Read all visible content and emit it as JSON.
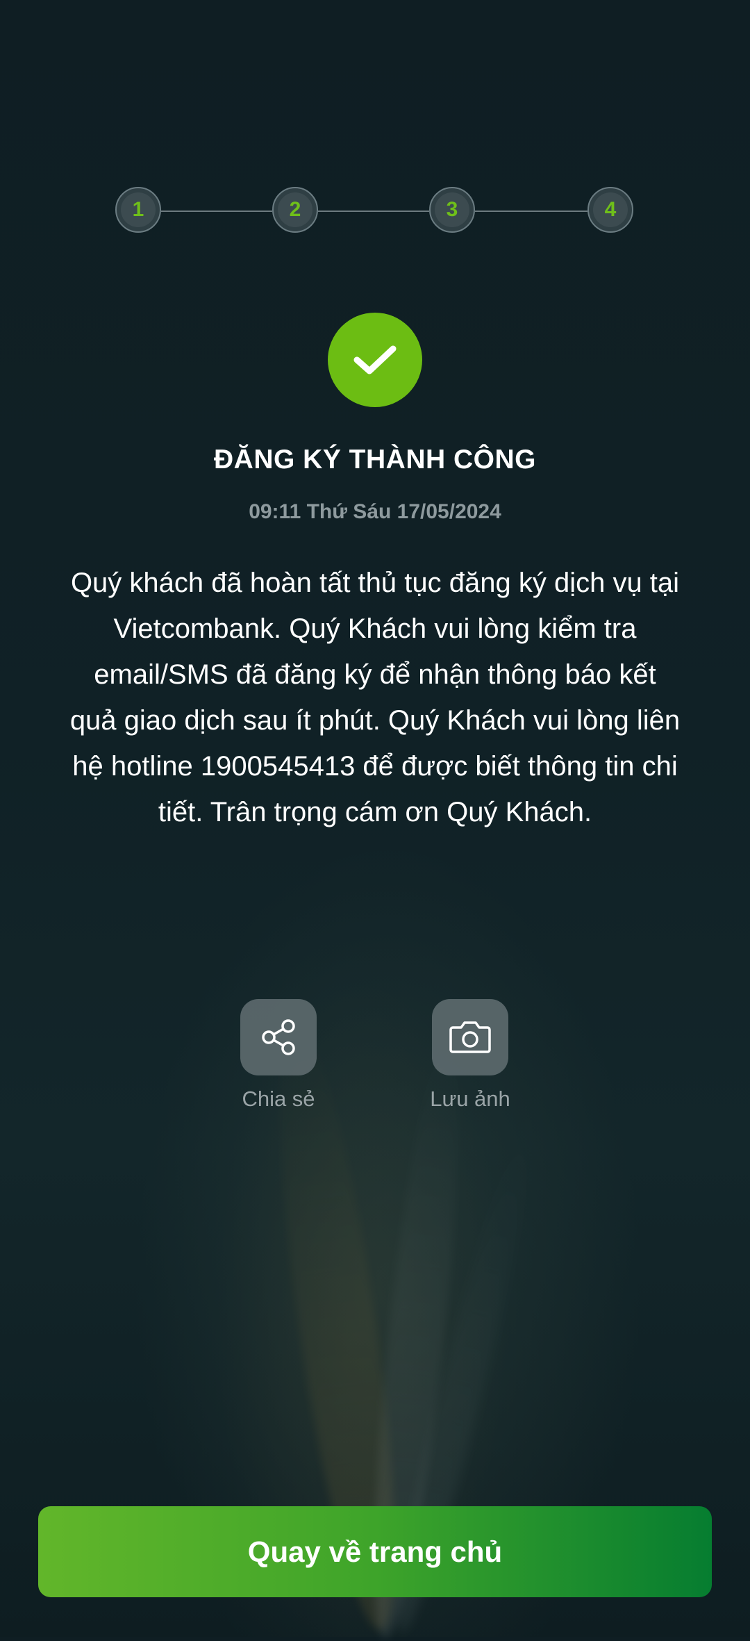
{
  "stepper": {
    "steps": [
      "1",
      "2",
      "3",
      "4"
    ]
  },
  "result": {
    "title": "ĐĂNG KÝ THÀNH CÔNG",
    "timestamp": "09:11 Thứ Sáu 17/05/2024",
    "message": "Quý khách đã hoàn tất thủ tục đăng ký dịch vụ tại Vietcombank. Quý Khách vui lòng kiểm tra email/SMS đã đăng ký để nhận thông báo kết quả giao dịch sau ít phút. Quý Khách vui lòng liên hệ hotline 1900545413 để được biết thông tin chi tiết. Trân trọng cám ơn Quý Khách."
  },
  "actions": {
    "share": {
      "label": "Chia sẻ",
      "icon": "share-icon"
    },
    "save_image": {
      "label": "Lưu ảnh",
      "icon": "camera-icon"
    }
  },
  "footer": {
    "home_button_label": "Quay về trang chủ"
  },
  "colors": {
    "accent": "#6cbd13",
    "background": "#0f1e23",
    "button_gradient_start": "#62b62a",
    "button_gradient_end": "#067d30"
  }
}
